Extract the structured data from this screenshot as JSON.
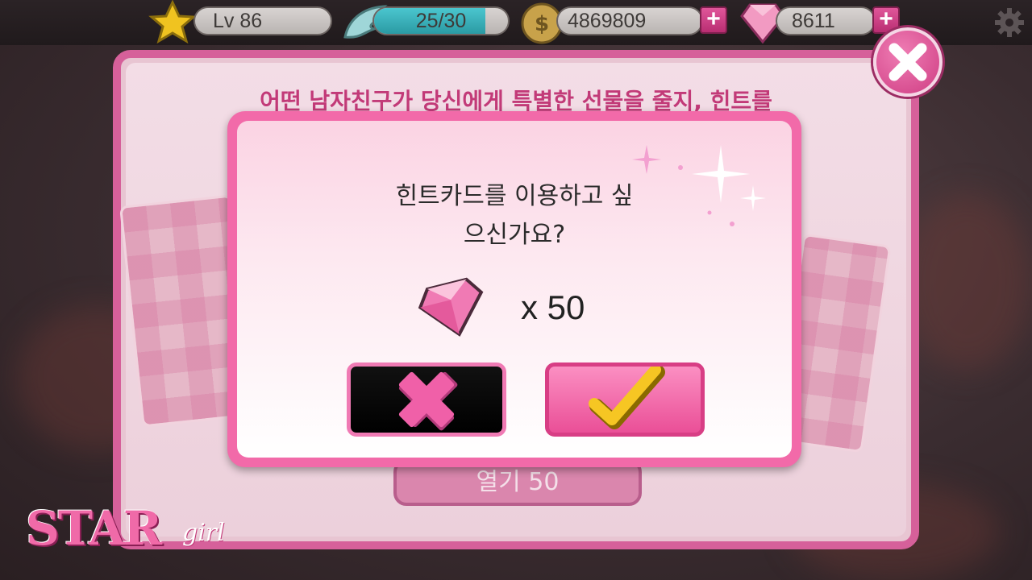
{
  "hud": {
    "level": "Lv 86",
    "energy": "25/30",
    "money": "4869809",
    "gems": "8611"
  },
  "panel": {
    "text": "어떤 남자친구가 당신에게 특별한 선물을 줄지, 힌트를",
    "button": "열기  50"
  },
  "dialog": {
    "line1": "힌트카드를 이용하고 싶",
    "line2": "으신가요?",
    "cost": "x 50"
  },
  "logo": {
    "main": "STAR",
    "sub": "girl"
  },
  "colors": {
    "accent": "#f26aa9",
    "panel_border": "#d6609a",
    "title_text": "#c23a78",
    "hud_bg": "#201a1c",
    "plus_button": "#d0448a"
  }
}
